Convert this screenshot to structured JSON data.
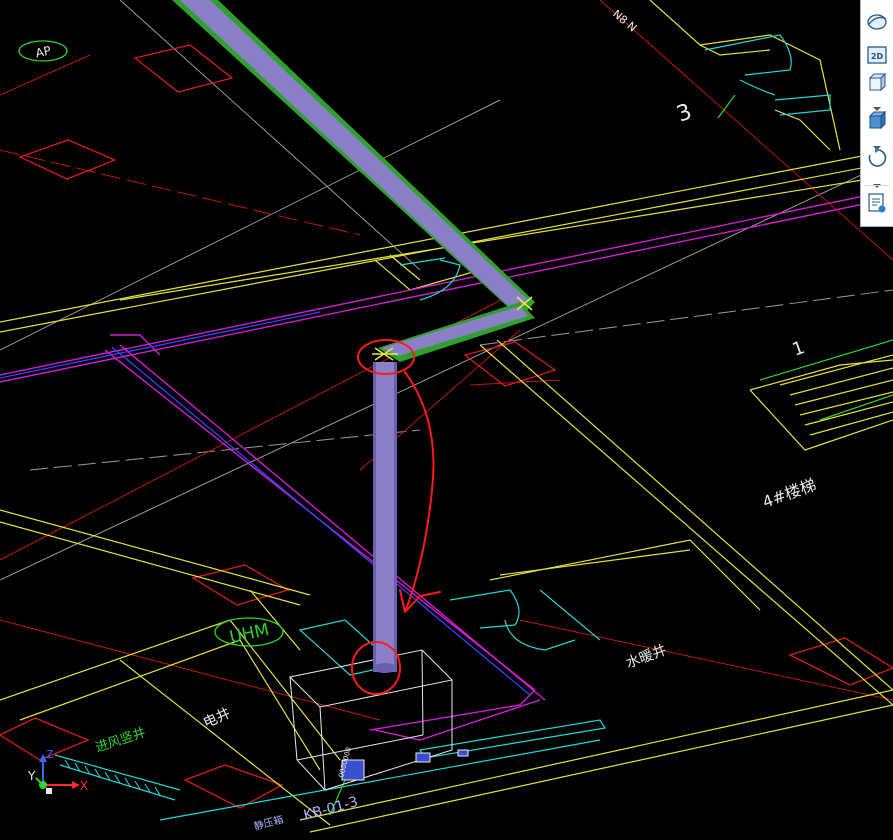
{
  "drawing": {
    "labels": {
      "ap_bubble": "AP",
      "uhm_bubble": "UHM",
      "number_3": "3",
      "number_1": "1",
      "stair_label": "4#楼梯",
      "water_well": "水暖井",
      "elec_well": "电井",
      "vent_shaft": "进风竖井",
      "room_code": "KB-01-3",
      "room_prefix": "静压箱",
      "box_text": "0000000",
      "top_mark": "N8 N"
    },
    "colors": {
      "background": "#000000",
      "wall_yellow": "#e3e33a",
      "magenta": "#d21cd2",
      "cyan": "#22d6d6",
      "red": "#d81b1b",
      "grid_gray": "#9a9a9a",
      "duct_fill": "#8b80c7",
      "duct_edge": "#3f9f2f",
      "box_white": "#e8e8e8",
      "annotation": "#ff1a1a"
    },
    "axis": {
      "x_label": "X",
      "y_label": "Y",
      "z_label": "Z"
    }
  },
  "toolbar": {
    "items": [
      {
        "name": "orbit-icon"
      },
      {
        "name": "view-2d-icon",
        "label": "2D"
      },
      {
        "name": "view-3d-cube-icon"
      },
      {
        "name": "view-3d-shaded-icon"
      },
      {
        "name": "rotate-icon"
      },
      {
        "name": "layer-settings-icon"
      }
    ]
  }
}
